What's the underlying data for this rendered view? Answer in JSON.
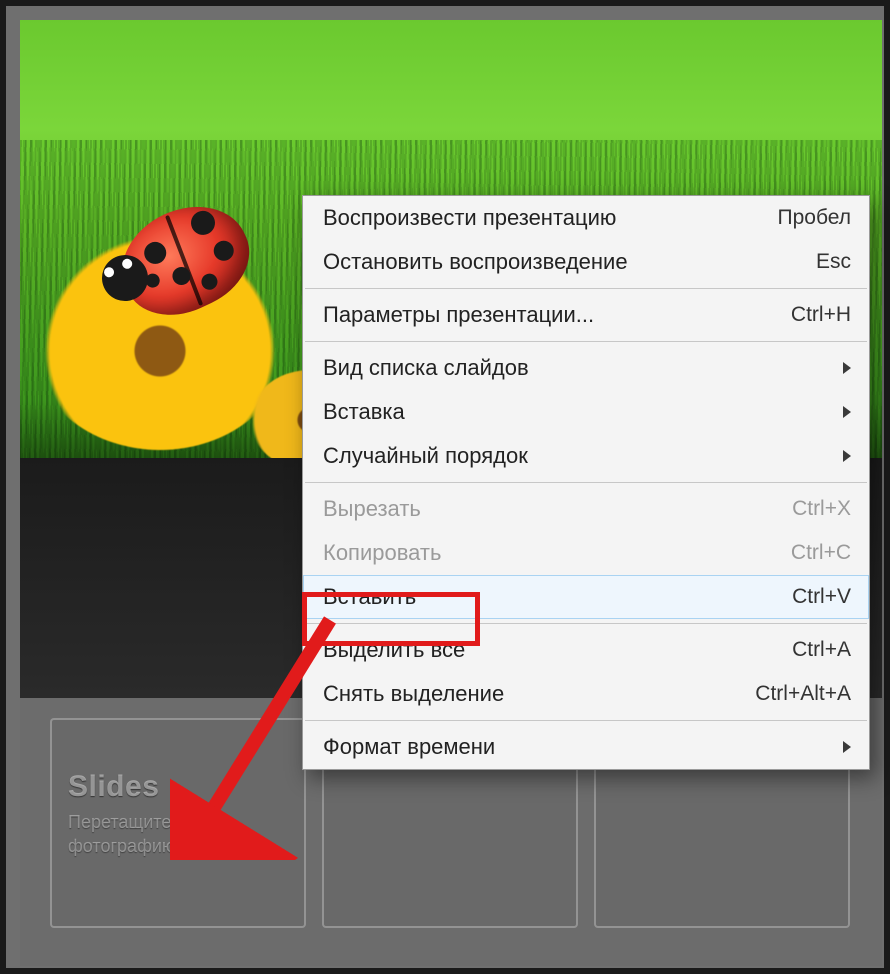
{
  "slides_panel": {
    "title": "Slides",
    "hint_line1": "Перетащите сюда",
    "hint_line2": "фотографию или видео."
  },
  "context_menu": {
    "groups": [
      [
        {
          "label": "Воспроизвести презентацию",
          "shortcut": "Пробел",
          "submenu": false,
          "disabled": false,
          "highlight": false,
          "name": "menu-play-presentation"
        },
        {
          "label": "Остановить воспроизведение",
          "shortcut": "Esc",
          "submenu": false,
          "disabled": false,
          "highlight": false,
          "name": "menu-stop-playback"
        }
      ],
      [
        {
          "label": "Параметры презентации...",
          "shortcut": "Ctrl+H",
          "submenu": false,
          "disabled": false,
          "highlight": false,
          "name": "menu-presentation-options"
        }
      ],
      [
        {
          "label": "Вид списка слайдов",
          "shortcut": "",
          "submenu": true,
          "disabled": false,
          "highlight": false,
          "name": "menu-slide-list-view"
        },
        {
          "label": "Вставка",
          "shortcut": "",
          "submenu": true,
          "disabled": false,
          "highlight": false,
          "name": "menu-insert"
        },
        {
          "label": "Случайный порядок",
          "shortcut": "",
          "submenu": true,
          "disabled": false,
          "highlight": false,
          "name": "menu-random-order"
        }
      ],
      [
        {
          "label": "Вырезать",
          "shortcut": "Ctrl+X",
          "submenu": false,
          "disabled": true,
          "highlight": false,
          "name": "menu-cut"
        },
        {
          "label": "Копировать",
          "shortcut": "Ctrl+C",
          "submenu": false,
          "disabled": true,
          "highlight": false,
          "name": "menu-copy"
        },
        {
          "label": "Вставить",
          "shortcut": "Ctrl+V",
          "submenu": false,
          "disabled": false,
          "highlight": true,
          "name": "menu-paste"
        }
      ],
      [
        {
          "label": "Выделить все",
          "shortcut": "Ctrl+A",
          "submenu": false,
          "disabled": false,
          "highlight": false,
          "name": "menu-select-all"
        },
        {
          "label": "Снять выделение",
          "shortcut": "Ctrl+Alt+A",
          "submenu": false,
          "disabled": false,
          "highlight": false,
          "name": "menu-deselect"
        }
      ],
      [
        {
          "label": "Формат времени",
          "shortcut": "",
          "submenu": true,
          "disabled": false,
          "highlight": false,
          "name": "menu-time-format"
        }
      ]
    ]
  },
  "annotation": {
    "highlight_color": "#e11b1b",
    "arrow_color": "#e11b1b"
  }
}
